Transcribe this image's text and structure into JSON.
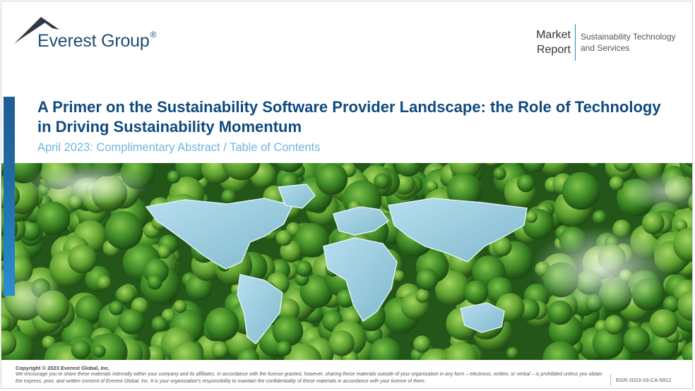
{
  "logo": {
    "text": "Everest Group",
    "mark": "®"
  },
  "report": {
    "type_line1": "Market",
    "type_line2": "Report",
    "topic": "Sustainability Technology and Services"
  },
  "title": "A Primer on the Sustainability Software Provider Landscape: the Role of Technology in Driving Sustainability Momentum",
  "subtitle": "April 2023: Complimentary Abstract / Table of Contents",
  "footer": {
    "copyright": "Copyright © 2023 Everest Global, Inc.",
    "disclaimer": "We encourage you to share these materials internally within your company and its affiliates. In accordance with the license granted, however, sharing these materials outside of your organization in any form – electronic, written, or verbal – is prohibited unless you obtain the express, prior, and written consent of Everest Global, Inc. It is your organization's responsibility to maintain the confidentiality of these materials in accordance with your license of them.",
    "doc_id": "EGR-2023-33-CA-5912"
  },
  "colors": {
    "title": "#0f4a7f",
    "subtitle": "#6fb6dd",
    "accent": "#1f6ea8",
    "forest": "#2f6b1f",
    "water": "#9ccfe0"
  },
  "hero": {
    "icon": "forest-world-map-image"
  }
}
